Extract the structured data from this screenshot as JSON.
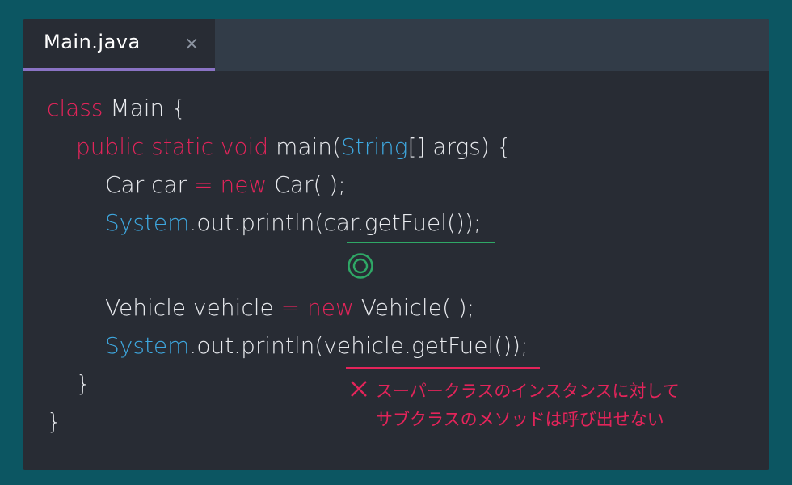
{
  "tab": {
    "title": "Main.java",
    "close": "×"
  },
  "code": {
    "l1_kw": "class",
    "l1_rest": " Main {",
    "l2_kw": "public static void",
    "l2_a": " main(",
    "l2_ty": "String",
    "l2_b": "[] args) {",
    "l3_a": "Car car ",
    "l3_eq": "=",
    "l3_kw": " new",
    "l3_b": " Car( );",
    "l4_ty": "System",
    "l4_rest": ".out.println(car.getFuel());",
    "l6_a": "Vehicle vehicle ",
    "l6_eq": "=",
    "l6_kw": " new",
    "l6_b": " Vehicle( );",
    "l7_ty": "System",
    "l7_rest": ".out.println(vehicle.getFuel());",
    "l8": "}",
    "l9": "}"
  },
  "annotations": {
    "ok_symbol": "double-circle",
    "ng_line1": "スーパークラスのインスタンスに対して",
    "ng_line2": "サブクラスのメソッドは呼び出せない"
  },
  "colors": {
    "background": "#0c5662",
    "editor": "#282c34",
    "keyword": "#e3245a",
    "type": "#3ea8e0",
    "ok": "#2fa866",
    "tab_indicator": "#8a73c4"
  }
}
